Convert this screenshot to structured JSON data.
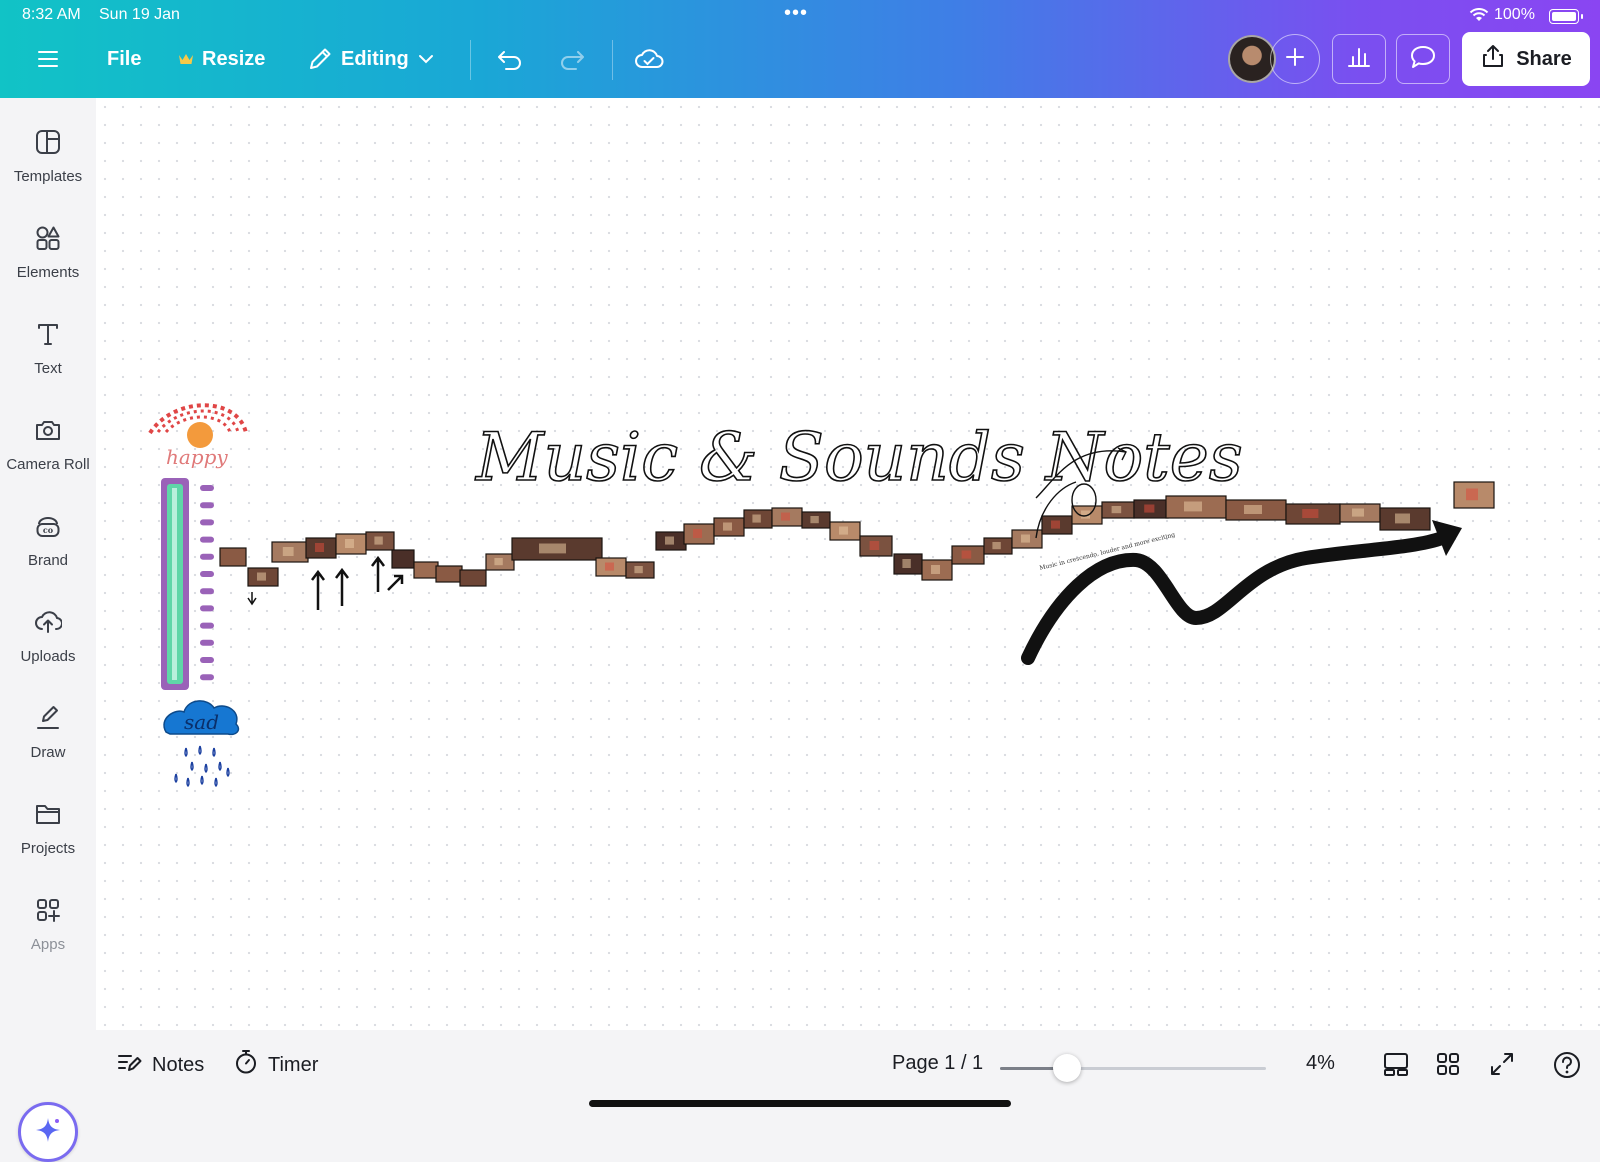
{
  "status_bar": {
    "time": "8:32 AM",
    "date": "Sun 19 Jan",
    "dots": "•••",
    "battery": "100%"
  },
  "toolbar": {
    "file_label": "File",
    "resize_label": "Resize",
    "editing_label": "Editing",
    "share_label": "Share"
  },
  "sidebar": {
    "items": [
      {
        "label": "Templates",
        "icon": "templates-icon"
      },
      {
        "label": "Elements",
        "icon": "elements-icon"
      },
      {
        "label": "Text",
        "icon": "text-icon"
      },
      {
        "label": "Camera Roll",
        "icon": "camera-icon"
      },
      {
        "label": "Brand",
        "icon": "brand-icon"
      },
      {
        "label": "Uploads",
        "icon": "uploads-icon"
      },
      {
        "label": "Draw",
        "icon": "draw-icon"
      },
      {
        "label": "Projects",
        "icon": "projects-icon"
      },
      {
        "label": "Apps",
        "icon": "apps-icon"
      }
    ]
  },
  "canvas": {
    "title": "Music & Sounds Notes",
    "happy_label": "happy",
    "sad_label": "sad",
    "annotation": "Music in crescendo, louder and more exciting"
  },
  "bottom_bar": {
    "notes_label": "Notes",
    "timer_label": "Timer",
    "page_label": "Page 1 / 1",
    "zoom_label": "4%",
    "zoom_fraction": 0.25
  },
  "colors": {
    "gradient_start": "#11c3c6",
    "gradient_end": "#8a45f2",
    "meter_green": "#5fd6a8",
    "meter_purple": "#9a62b8",
    "sun": "#f39a3c",
    "cloud": "#1677d2"
  }
}
